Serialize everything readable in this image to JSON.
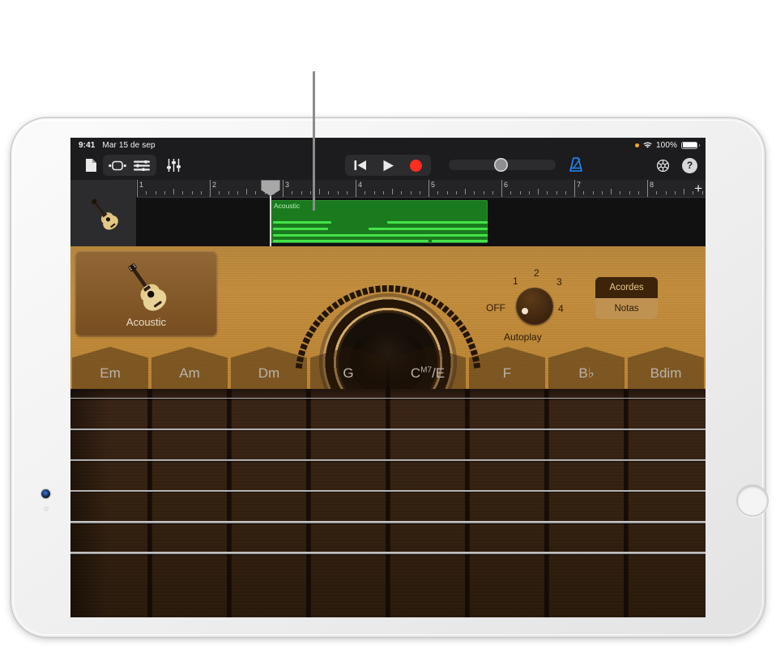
{
  "status_bar": {
    "time": "9:41",
    "date": "Mar 15 de sep",
    "battery_percent": "100%",
    "icons": [
      "orange-recording-dot",
      "wifi-icon",
      "battery-icon"
    ]
  },
  "toolbar": {
    "left_buttons": [
      {
        "name": "my-songs-button",
        "icon": "document-icon"
      },
      {
        "name": "loop-browser-button",
        "icon": "loop-region-icon"
      },
      {
        "name": "tracks-view-button",
        "icon": "track-list-icon"
      },
      {
        "name": "mixer-button",
        "icon": "faders-icon"
      }
    ],
    "transport": [
      {
        "name": "rewind-button",
        "icon": "rewind-to-start-icon"
      },
      {
        "name": "play-button",
        "icon": "play-icon"
      },
      {
        "name": "record-button",
        "icon": "record-dot-icon"
      }
    ],
    "master_volume_label": "Master Volume",
    "metronome": {
      "name": "metronome-button",
      "icon": "metronome-icon",
      "active": true
    },
    "right_buttons": [
      {
        "name": "settings-button",
        "icon": "gear-icon"
      },
      {
        "name": "help-button",
        "icon": "question-mark-icon",
        "label": "?"
      }
    ]
  },
  "tracks": {
    "add_track_label": "+",
    "ruler_measures": [
      "1",
      "2",
      "3",
      "4",
      "5",
      "6",
      "7",
      "8"
    ],
    "playhead_position_measure": "3",
    "track_header_icon": "acoustic-guitar-icon",
    "region": {
      "name": "Acoustic",
      "start_measure": "3",
      "end_measure": "6"
    }
  },
  "instrument": {
    "picker_label": "Acoustic",
    "picker_icon": "acoustic-guitar-icon",
    "autoplay": {
      "label": "Autoplay",
      "positions": [
        "OFF",
        "1",
        "2",
        "3",
        "4"
      ],
      "selected": "OFF"
    },
    "mode_toggle": {
      "options": [
        "Acordes",
        "Notas"
      ],
      "selected": "Acordes"
    },
    "chords": [
      {
        "root": "Em",
        "sup": "",
        "suffix": ""
      },
      {
        "root": "Am",
        "sup": "",
        "suffix": ""
      },
      {
        "root": "Dm",
        "sup": "",
        "suffix": ""
      },
      {
        "root": "G",
        "sup": "",
        "suffix": ""
      },
      {
        "root": "C",
        "sup": "M7",
        "suffix": "/E"
      },
      {
        "root": "F",
        "sup": "",
        "suffix": ""
      },
      {
        "root": "B♭",
        "sup": "",
        "suffix": ""
      },
      {
        "root": "Bdim",
        "sup": "",
        "suffix": ""
      }
    ],
    "fretboard_strings": 6,
    "fretboard_frets": 8
  },
  "callout": {
    "name": "callout-pointer-line"
  },
  "colors": {
    "screen_background": "#1c1c1e",
    "region_green": "#1a7a1e",
    "note_green": "#45e24a",
    "record_red": "#ff2d20",
    "metronome_blue": "#1f8bff",
    "guitar_body": "#b9812f",
    "fretboard": "#33200f"
  }
}
